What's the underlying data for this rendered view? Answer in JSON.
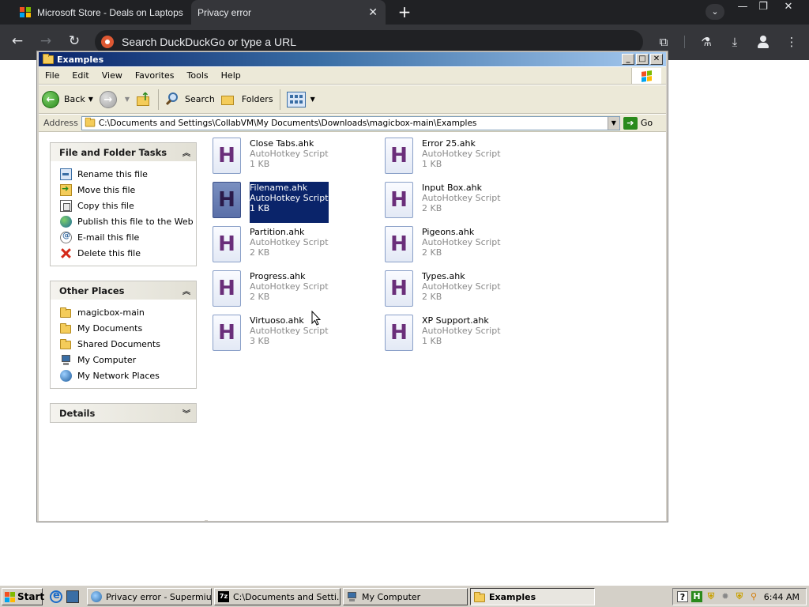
{
  "browser": {
    "tabs": [
      {
        "title": "Microsoft Store - Deals on Laptops"
      },
      {
        "title": "Privacy error"
      }
    ],
    "omnibox_placeholder": "Search DuckDuckGo or type a URL"
  },
  "window": {
    "title": "Examples",
    "menu": [
      "File",
      "Edit",
      "View",
      "Favorites",
      "Tools",
      "Help"
    ],
    "toolbar": {
      "back": "Back",
      "search": "Search",
      "folders": "Folders"
    },
    "address": {
      "label": "Address",
      "path": "C:\\Documents and Settings\\CollabVM\\My Documents\\Downloads\\magicbox-main\\Examples",
      "go": "Go"
    }
  },
  "taskpane": {
    "file_tasks": {
      "title": "File and Folder Tasks",
      "items": [
        "Rename this file",
        "Move this file",
        "Copy this file",
        "Publish this file to the Web",
        "E-mail this file",
        "Delete this file"
      ]
    },
    "other_places": {
      "title": "Other Places",
      "items": [
        "magicbox-main",
        "My Documents",
        "Shared Documents",
        "My Computer",
        "My Network Places"
      ]
    },
    "details": {
      "title": "Details"
    }
  },
  "files": [
    {
      "name": "Close Tabs.ahk",
      "type": "AutoHotkey Script",
      "size": "1 KB"
    },
    {
      "name": "Error 25.ahk",
      "type": "AutoHotkey Script",
      "size": "1 KB"
    },
    {
      "name": "Filename.ahk",
      "type": "AutoHotkey Script",
      "size": "1 KB",
      "selected": true
    },
    {
      "name": "Input Box.ahk",
      "type": "AutoHotkey Script",
      "size": "2 KB"
    },
    {
      "name": "Partition.ahk",
      "type": "AutoHotkey Script",
      "size": "2 KB"
    },
    {
      "name": "Pigeons.ahk",
      "type": "AutoHotkey Script",
      "size": "2 KB"
    },
    {
      "name": "Progress.ahk",
      "type": "AutoHotkey Script",
      "size": "2 KB"
    },
    {
      "name": "Types.ahk",
      "type": "AutoHotkey Script",
      "size": "2 KB"
    },
    {
      "name": "Virtuoso.ahk",
      "type": "AutoHotkey Script",
      "size": "3 KB"
    },
    {
      "name": "XP Support.ahk",
      "type": "AutoHotkey Script",
      "size": "1 KB"
    }
  ],
  "taskbar": {
    "start": "Start",
    "tasks": [
      "Privacy error - Supermium",
      "C:\\Documents and Setti...",
      "My Computer",
      "Examples"
    ],
    "clock": "6:44 AM"
  },
  "colors": {
    "selection": "#0a246a",
    "ahk_letter": "#6a2e7a",
    "xp_face": "#ece9d8"
  }
}
